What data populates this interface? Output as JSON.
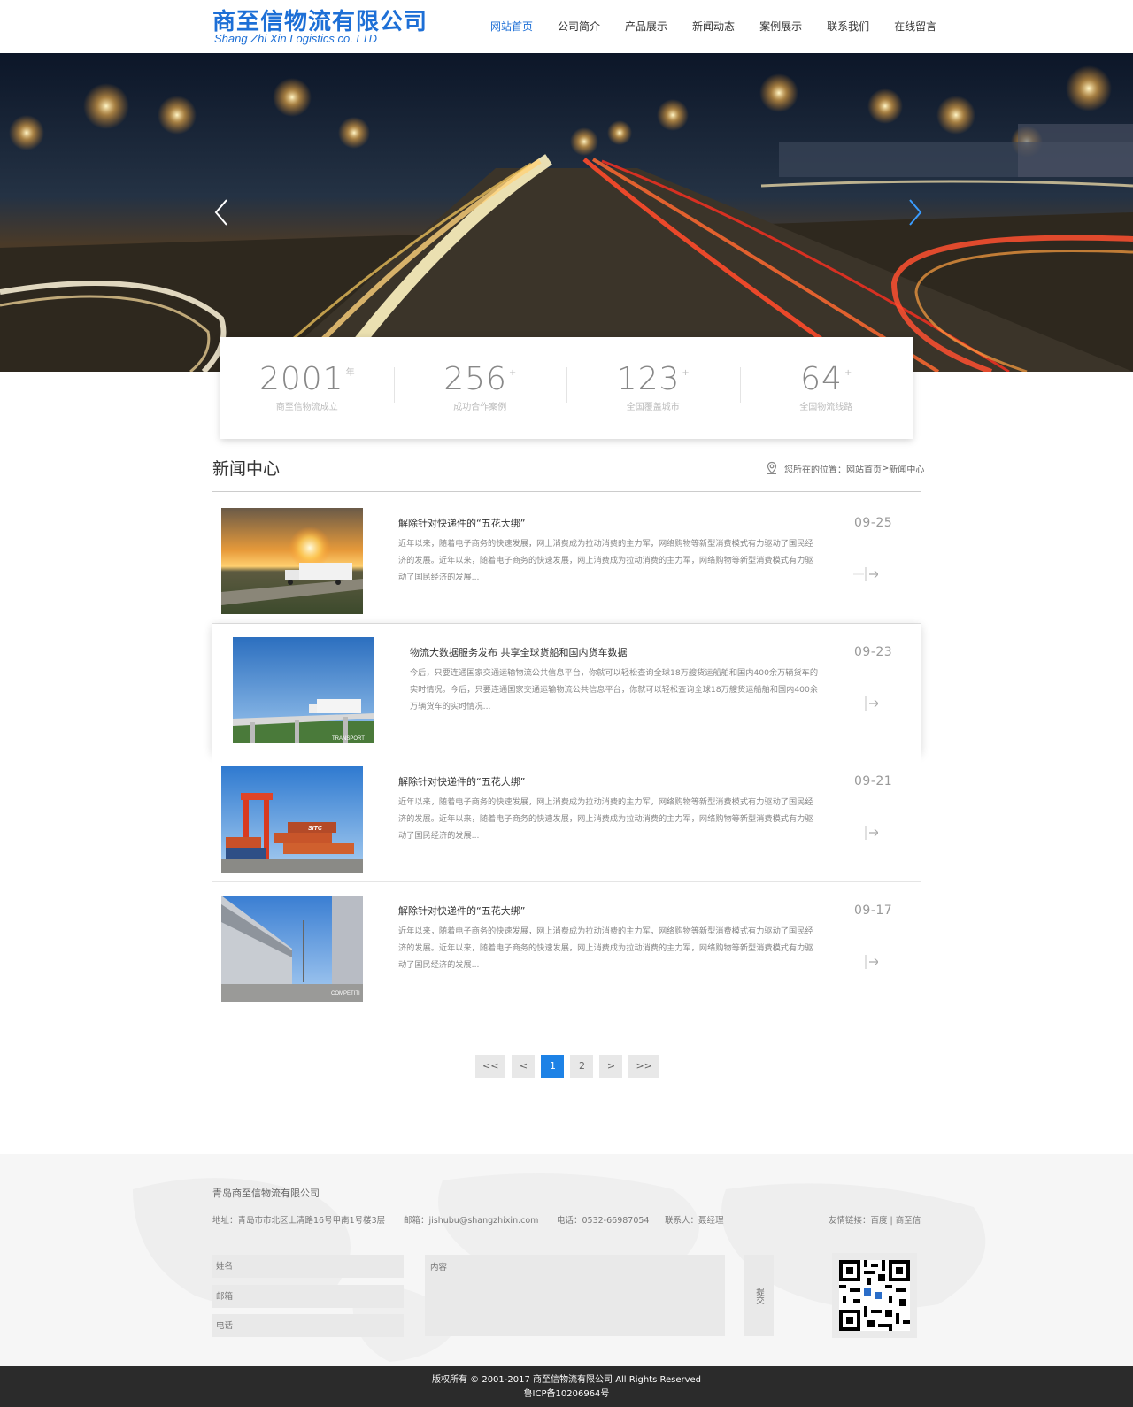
{
  "header": {
    "logo_cn": "商至信物流有限公司",
    "logo_en": "Shang Zhi Xin Logistics co. LTD",
    "nav": [
      "网站首页",
      "公司简介",
      "产品展示",
      "新闻动态",
      "案例展示",
      "联系我们",
      "在线留言"
    ],
    "active_index": 0,
    "accent_color": "#1d6fd6"
  },
  "stats": [
    {
      "value": "2001",
      "sup": "年",
      "label": "商至信物流成立"
    },
    {
      "value": "256",
      "sup": "+",
      "label": "成功合作案例"
    },
    {
      "value": "123",
      "sup": "+",
      "label": "全国覆盖城市"
    },
    {
      "value": "64",
      "sup": "+",
      "label": "全国物流线路"
    }
  ],
  "section": {
    "title": "新闻中心",
    "breadcrumb_prefix": "您所在的位置：",
    "breadcrumb_home": "网站首页",
    "breadcrumb_sep": " > ",
    "breadcrumb_current": "新闻中心"
  },
  "news": [
    {
      "title": "解除针对快递件的“五花大绑”",
      "date": "09-25",
      "desc": "近年以来，随着电子商务的快速发展，网上消费成为拉动消费的主力军，网络购物等新型消费模式有力驱动了国民经济的发展。近年以来，随着电子商务的快速发展，网上消费成为拉动消费的主力军，网络购物等新型消费模式有力驱动了国民经济的发展..."
    },
    {
      "title": "物流大数据服务发布 共享全球货船和国内货车数据",
      "date": "09-23",
      "desc": "今后，只要连通国家交通运输物流公共信息平台，你就可以轻松查询全球18万艘货运船舶和国内400余万辆货车的实时情况。今后，只要连通国家交通运输物流公共信息平台，你就可以轻松查询全球18万艘货运船舶和国内400余万辆货车的实时情况..."
    },
    {
      "title": "解除针对快递件的“五花大绑”",
      "date": "09-21",
      "desc": "近年以来，随着电子商务的快速发展，网上消费成为拉动消费的主力军，网络购物等新型消费模式有力驱动了国民经济的发展。近年以来，随着电子商务的快速发展，网上消费成为拉动消费的主力军，网络购物等新型消费模式有力驱动了国民经济的发展..."
    },
    {
      "title": "解除针对快递件的“五花大绑”",
      "date": "09-17",
      "desc": "近年以来，随着电子商务的快速发展，网上消费成为拉动消费的主力军，网络购物等新型消费模式有力驱动了国民经济的发展。近年以来，随着电子商务的快速发展，网上消费成为拉动消费的主力军，网络购物等新型消费模式有力驱动了国民经济的发展..."
    }
  ],
  "thumb_labels": {
    "transport": "TRANSPORT",
    "sitc": "SITC",
    "competit": "COMPETITI"
  },
  "pagination": {
    "first": "<<",
    "prev": "<",
    "pages": [
      "1",
      "2"
    ],
    "next": ">",
    "last": ">>",
    "active": "1"
  },
  "footer": {
    "company": "青岛商至信物流有限公司",
    "address": "地址：青岛市市北区上清路16号甲南1号楼3层",
    "email": "邮箱：jishubu@shangzhixin.com",
    "phone": "电话：0532-66987054",
    "contact": "联系人：聂经理",
    "links_prefix": "友情链接：",
    "link1": "百度",
    "link_sep": " | ",
    "link2": "商至信",
    "name_placeholder": "姓名",
    "email_placeholder": "邮箱",
    "phone_placeholder": "电话",
    "content_placeholder": "内容",
    "submit_label": "提交"
  },
  "copyright": {
    "line1": "版权所有 © 2001-2017 商至信物流有限公司 All Rights Reserved",
    "line2": "鲁ICP备10206964号"
  }
}
